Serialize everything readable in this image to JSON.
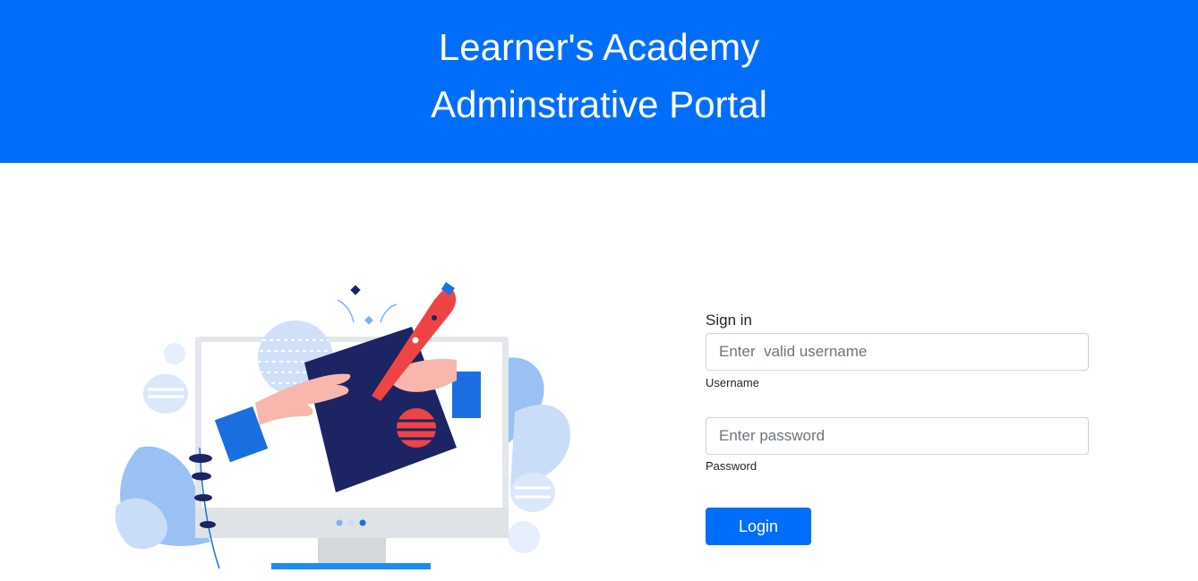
{
  "header": {
    "title_line1": "Learner's Academy",
    "title_line2": "Adminstrative Portal"
  },
  "form": {
    "signin_label": "Sign in",
    "username_placeholder": "Enter  valid username",
    "username_value": "",
    "username_help": "Username",
    "password_placeholder": "Enter password",
    "password_value": "",
    "password_help": "Password",
    "login_label": "Login"
  },
  "colors": {
    "primary": "#006efb",
    "header_text": "#ffffff"
  },
  "illustration": {
    "icon": "monitor-writing-illustration"
  }
}
